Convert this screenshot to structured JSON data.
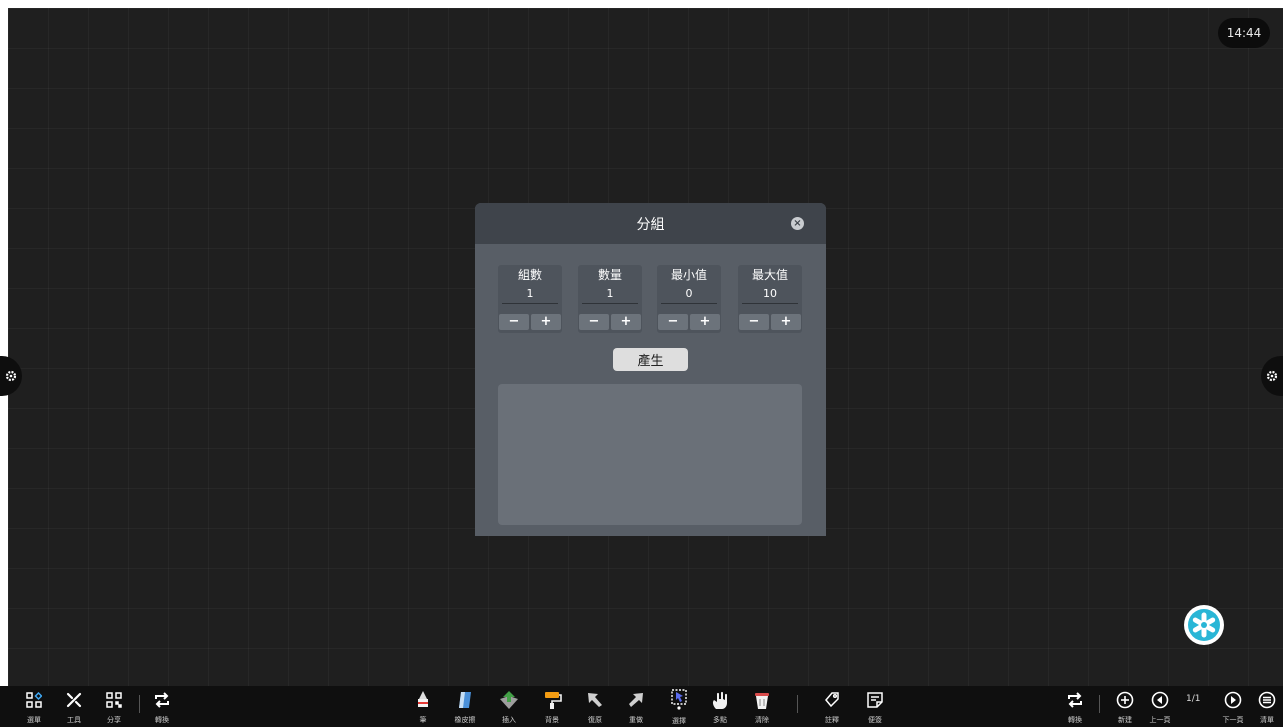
{
  "clock": "14:44",
  "dialog": {
    "title": "分組",
    "fields": [
      {
        "label": "組數",
        "value": "1"
      },
      {
        "label": "數量",
        "value": "1"
      },
      {
        "label": "最小值",
        "value": "0"
      },
      {
        "label": "最大值",
        "value": "10"
      }
    ],
    "minus": "−",
    "plus": "+",
    "close": "×",
    "generate_label": "產生"
  },
  "toolbar": {
    "left": [
      {
        "label": "選單",
        "icon": "menu-grid-icon"
      },
      {
        "label": "工具",
        "icon": "tools-icon"
      },
      {
        "label": "分享",
        "icon": "qr-code-icon"
      },
      {
        "label": "轉換",
        "icon": "switch-icon"
      }
    ],
    "center": [
      {
        "label": "筆",
        "icon": "pen-icon"
      },
      {
        "label": "橡皮擦",
        "icon": "eraser-icon"
      },
      {
        "label": "插入",
        "icon": "insert-icon"
      },
      {
        "label": "背景",
        "icon": "background-roller-icon"
      },
      {
        "label": "復原",
        "icon": "undo-arrow-icon"
      },
      {
        "label": "重做",
        "icon": "redo-arrow-icon"
      },
      {
        "label": "選擇",
        "icon": "select-icon"
      },
      {
        "label": "多點",
        "icon": "multi-touch-icon"
      },
      {
        "label": "清除",
        "icon": "trash-icon"
      },
      {
        "label": "註釋",
        "icon": "annotation-icon"
      },
      {
        "label": "便簽",
        "icon": "sticky-note-icon"
      }
    ],
    "right": [
      {
        "label": "轉換",
        "icon": "switch-icon"
      },
      {
        "label": "新建",
        "icon": "add-page-icon"
      },
      {
        "label": "上一頁",
        "icon": "prev-page-icon"
      },
      {
        "label": "下一頁",
        "icon": "next-page-icon"
      },
      {
        "label": "清單",
        "icon": "page-list-icon"
      }
    ],
    "page_indicator": "1/1"
  },
  "colors": {
    "canvas": "#1f1f1f",
    "dialog_header": "#3f444b",
    "dialog_body": "#585e66",
    "fab_accent": "#29b6d6"
  }
}
